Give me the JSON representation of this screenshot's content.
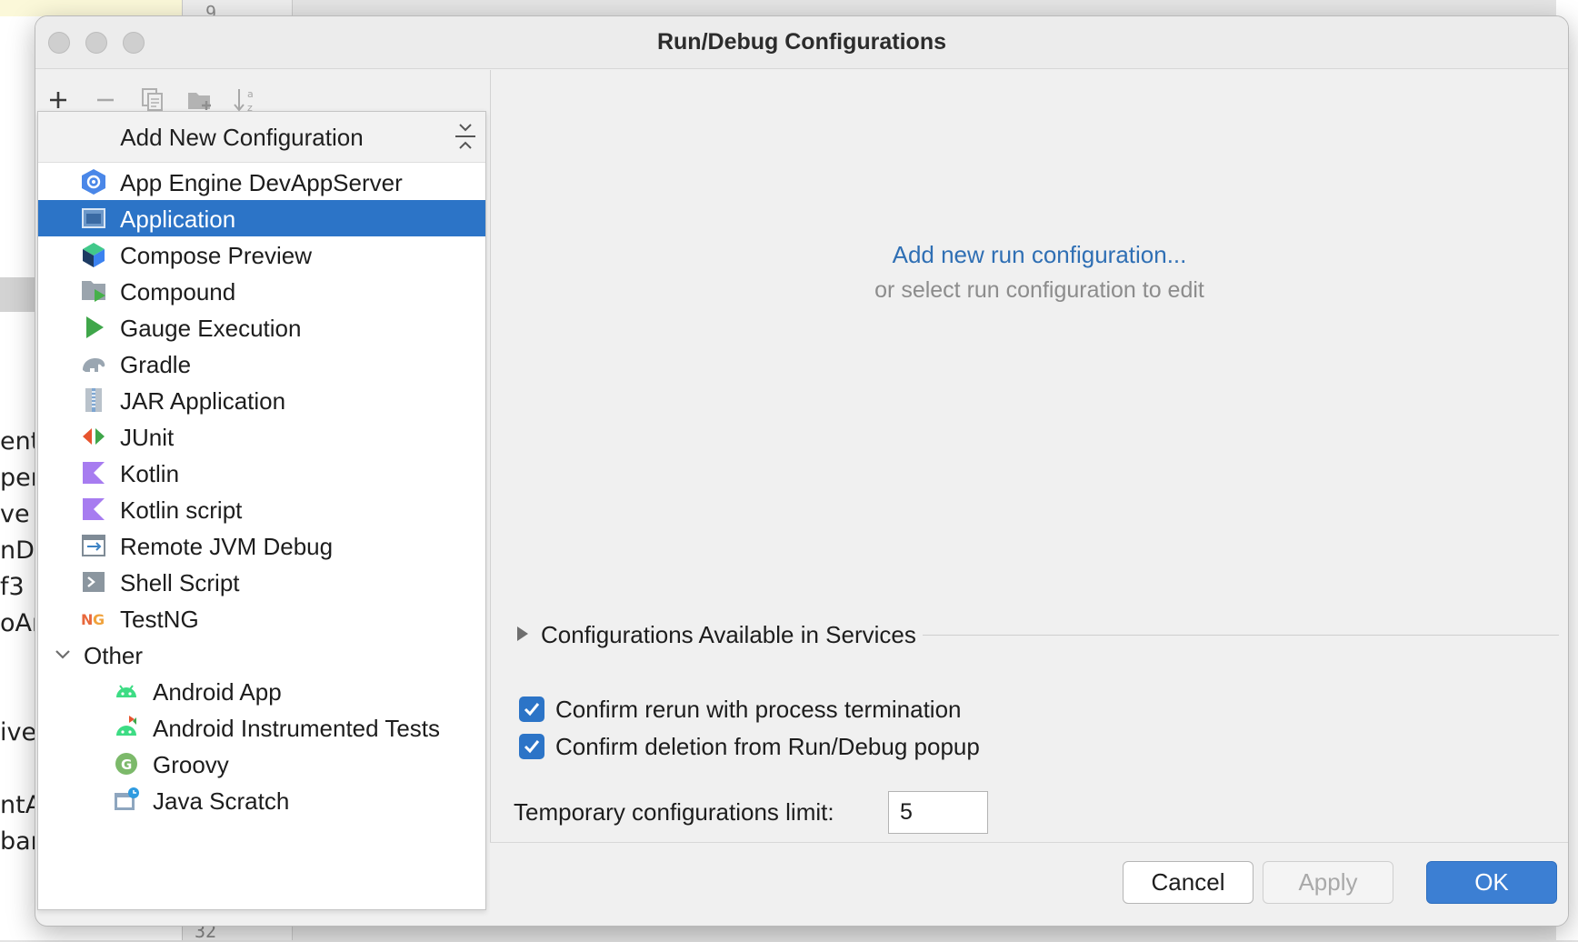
{
  "background": {
    "fragments": [
      "ent",
      "per",
      "ve",
      "nDi",
      "f3",
      "oAr",
      "ive",
      "ntAr",
      "bar"
    ],
    "line_numbers": [
      "9",
      "32"
    ]
  },
  "dialog": {
    "title": "Run/Debug Configurations"
  },
  "toolbar": {
    "add_icon": "plus-icon",
    "remove_icon": "minus-icon",
    "copy_icon": "copy-icon",
    "folder_icon": "new-folder-icon",
    "sort_icon": "sort-alpha-icon"
  },
  "popup": {
    "title": "Add New Configuration",
    "items": [
      {
        "label": "App Engine DevAppServer",
        "icon": "app-engine-icon"
      },
      {
        "label": "Application",
        "icon": "application-window-icon",
        "selected": true
      },
      {
        "label": "Compose Preview",
        "icon": "compose-cube-icon"
      },
      {
        "label": "Compound",
        "icon": "compound-folder-icon"
      },
      {
        "label": "Gauge Execution",
        "icon": "play-triangle-icon"
      },
      {
        "label": "Gradle",
        "icon": "gradle-elephant-icon"
      },
      {
        "label": "JAR Application",
        "icon": "jar-file-icon"
      },
      {
        "label": "JUnit",
        "icon": "junit-arrows-icon"
      },
      {
        "label": "Kotlin",
        "icon": "kotlin-icon"
      },
      {
        "label": "Kotlin script",
        "icon": "kotlin-script-icon"
      },
      {
        "label": "Remote JVM Debug",
        "icon": "remote-debug-icon"
      },
      {
        "label": "Shell Script",
        "icon": "shell-script-icon"
      },
      {
        "label": "TestNG",
        "icon": "testng-icon"
      }
    ],
    "group": {
      "label": "Other",
      "icon": "chevron-down-icon",
      "items": [
        {
          "label": "Android App",
          "icon": "android-icon"
        },
        {
          "label": "Android Instrumented Tests",
          "icon": "android-test-icon"
        },
        {
          "label": "Groovy",
          "icon": "groovy-icon"
        },
        {
          "label": "Java Scratch",
          "icon": "java-scratch-icon"
        }
      ]
    }
  },
  "main": {
    "hint_link": "Add new run configuration...",
    "hint_sub": "or select run configuration to edit",
    "services_label": "Configurations Available in Services",
    "confirm_rerun": {
      "label": "Confirm rerun with process termination",
      "checked": true
    },
    "confirm_deletion": {
      "label": "Confirm deletion from Run/Debug popup",
      "checked": true
    },
    "temp_limit_label": "Temporary configurations limit:",
    "temp_limit_value": "5"
  },
  "buttons": {
    "cancel": "Cancel",
    "apply": "Apply",
    "ok": "OK"
  },
  "colors": {
    "selection": "#2c74c7",
    "link": "#2f6fb4",
    "primary_button": "#3c7fd3"
  }
}
